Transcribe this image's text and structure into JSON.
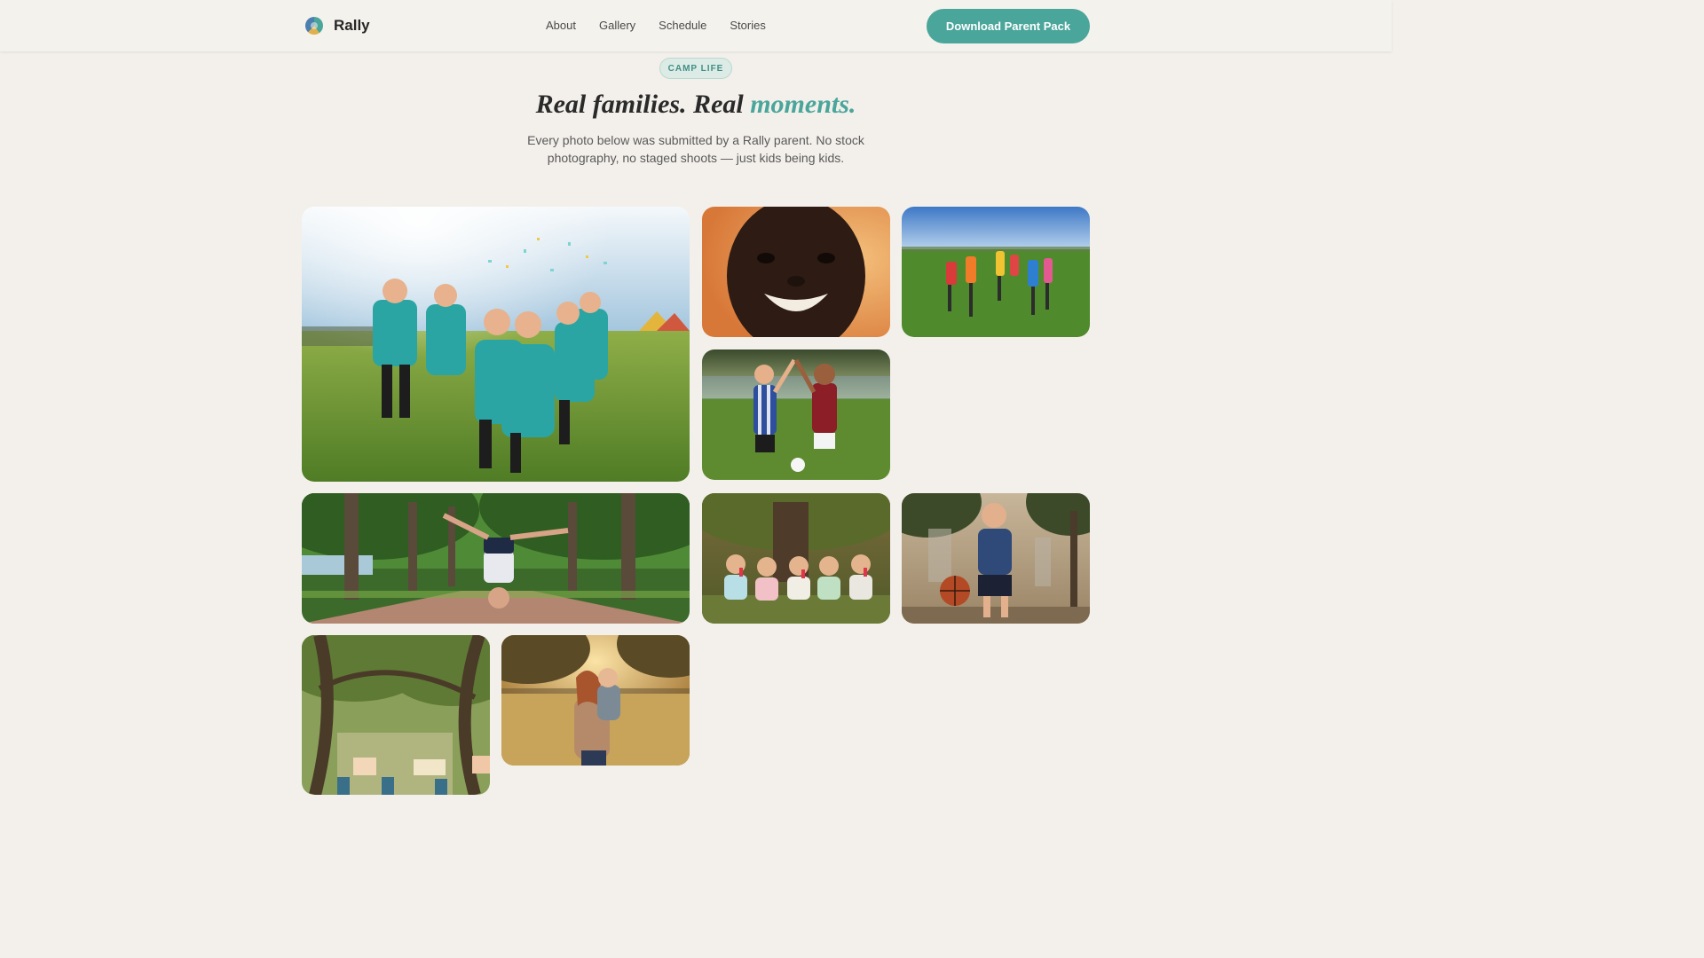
{
  "brand": {
    "name": "Rally",
    "logo_icon": "rally-logo-icon"
  },
  "nav": {
    "items": [
      {
        "label": "About"
      },
      {
        "label": "Gallery"
      },
      {
        "label": "Schedule"
      },
      {
        "label": "Stories"
      }
    ]
  },
  "cta": {
    "label": "Download Parent Pack",
    "color": "#4aa59b"
  },
  "hero": {
    "badge": "CAMP LIFE",
    "title_part1": "Real families. Real ",
    "title_accent": "moments.",
    "subtitle": "Every photo below was submitted by a Rally parent. No stock photography, no staged shoots — just kids being kids."
  },
  "colors": {
    "background": "#f3f0eb",
    "accent": "#4aa59b"
  },
  "gallery": {
    "photos": [
      {
        "name": "photo-camp-team-celebration",
        "subject": "kids in teal camp jerseys cheering with confetti"
      },
      {
        "name": "photo-smiling-child-portrait",
        "subject": "close-up of a smiling child"
      },
      {
        "name": "photo-kids-circle-field",
        "subject": "kids holding hands in a circle on a field"
      },
      {
        "name": "photo-soccer-high-five",
        "subject": "two young soccer players high-fiving"
      },
      {
        "name": "photo-cartwheel-tree-path",
        "subject": "child doing a cartwheel on a tree-lined path"
      },
      {
        "name": "photo-kids-popsicles-tree",
        "subject": "kids eating popsicles under a tree"
      },
      {
        "name": "photo-boy-basketball",
        "subject": "boy dribbling a basketball"
      },
      {
        "name": "photo-explore-signs-oaks",
        "subject": "group with signs under oak trees"
      },
      {
        "name": "photo-parent-child-meadow",
        "subject": "parent hugging a child in a meadow"
      }
    ]
  }
}
